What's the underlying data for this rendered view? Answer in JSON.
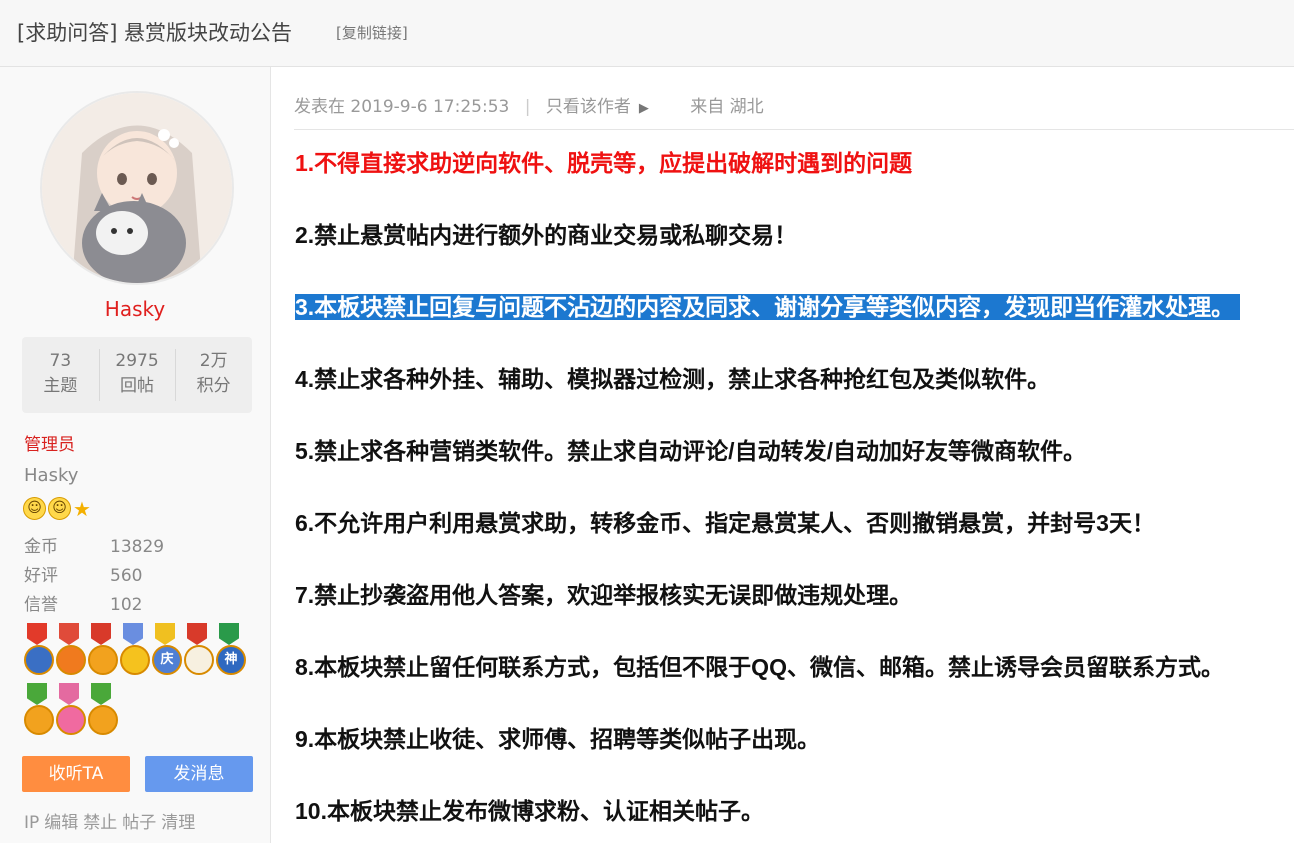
{
  "header": {
    "title": "[求助问答] 悬赏版块改动公告",
    "copy_link": "[复制链接]"
  },
  "author": {
    "name": "Hasky",
    "stats": [
      {
        "value": "73",
        "label": "主题"
      },
      {
        "value": "2975",
        "label": "回帖"
      },
      {
        "value": "2万",
        "label": "积分"
      }
    ],
    "group": "管理员",
    "group_name": "Hasky",
    "rank_icons": [
      "smiley-icon",
      "smiley-icon",
      "star-icon"
    ],
    "info": [
      {
        "key": "金币",
        "value": "13829"
      },
      {
        "key": "好评",
        "value": "560"
      },
      {
        "key": "信誉",
        "value": "102"
      }
    ],
    "medal_glyphs": {
      "m5": "庆",
      "m7": "神"
    },
    "follow_label": "收听TA",
    "message_label": "发消息",
    "admin_links": [
      "IP",
      "编辑",
      "禁止",
      "帖子",
      "清理"
    ]
  },
  "post": {
    "posted_prefix": "发表在",
    "posted_time": "2019-9-6 17:25:53",
    "separator": "|",
    "only_author": "只看该作者",
    "location": "来自 湖北",
    "rules": [
      "1.不得直接求助逆向软件、脱壳等，应提出破解时遇到的问题",
      "2.禁止悬赏帖内进行额外的商业交易或私聊交易！",
      "3.本板块禁止回复与问题不沾边的内容及同求、谢谢分享等类似内容，发现即当作灌水处理。",
      "4.禁止求各种外挂、辅助、模拟器过检测，禁止求各种抢红包及类似软件。",
      "5.禁止求各种营销类软件。禁止求自动评论/自动转发/自动加好友等微商软件。",
      "6.不允许用户利用悬赏求助，转移金币、指定悬赏某人、否则撤销悬赏，并封号3天！",
      "7.禁止抄袭盗用他人答案，欢迎举报核实无误即做违规处理。",
      "8.本板块禁止留任何联系方式，包括但不限于QQ、微信、邮箱。禁止诱导会员留联系方式。",
      "9.本板块禁止收徒、求师傅、招聘等类似帖子出现。",
      "10.本板块禁止发布微博求粉、认证相关帖子。"
    ]
  },
  "colors": {
    "username": "#e0201f",
    "rule_red": "#ef1111",
    "highlight": "#1c78d0",
    "follow_button": "#ff8d40",
    "message_button": "#6699ee"
  }
}
